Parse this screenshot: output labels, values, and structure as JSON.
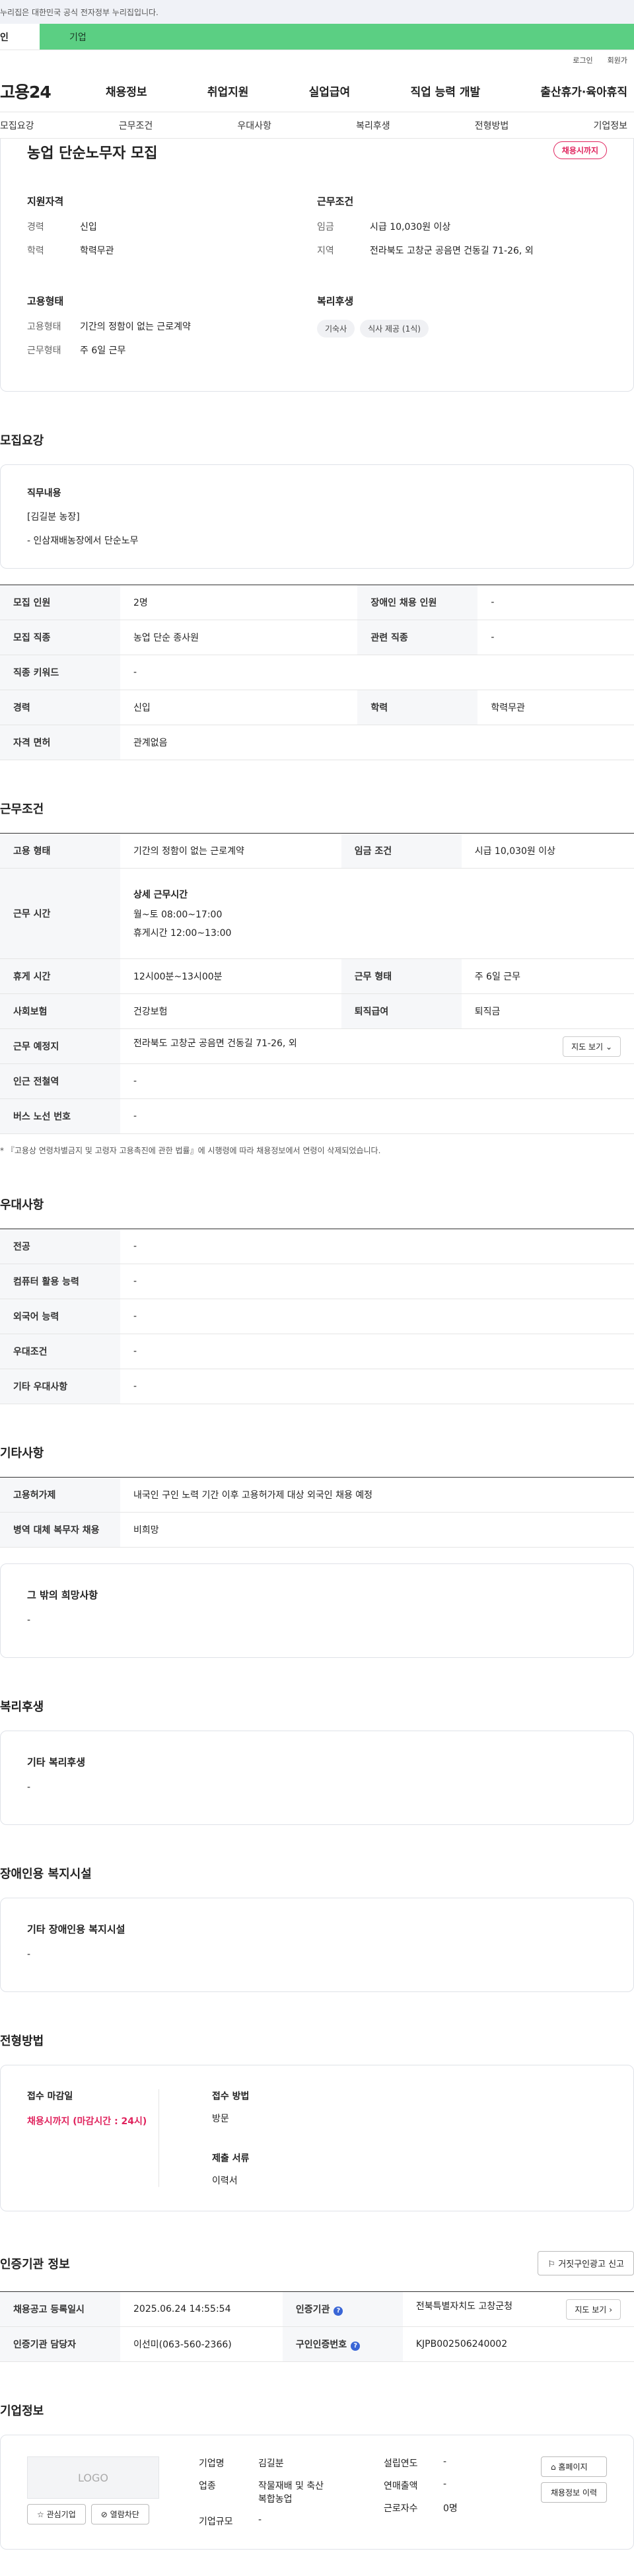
{
  "gov_notice": "누리집은 대한민국 공식 전자정부 누리집입니다.",
  "user_tabs": [
    "인",
    "기업"
  ],
  "util": [
    "로그인",
    "회원가"
  ],
  "logo": "고용24",
  "gnb": [
    "채용정보",
    "취업지원",
    "실업급여",
    "직업 능력 개발",
    "출산휴가·육아휴직"
  ],
  "anchors": [
    "모집요강",
    "근무조건",
    "우대사항",
    "복리후생",
    "전형방법",
    "기업정보"
  ],
  "summary": {
    "title": "농업 단순노무자 모집",
    "badge": "채용시까지",
    "qual_title": "지원자격",
    "qual": [
      {
        "k": "경력",
        "v": "신입"
      },
      {
        "k": "학력",
        "v": "학력무관"
      }
    ],
    "cond_title": "근무조건",
    "cond": [
      {
        "k": "임금",
        "v": "시급 10,030원 이상"
      },
      {
        "k": "지역",
        "v": "전라북도 고창군 공음면 건동길 71-26, 외"
      }
    ],
    "emp_title": "고용형태",
    "emp": [
      {
        "k": "고용형태",
        "v": "기간의 정함이 없는 근로계약"
      },
      {
        "k": "근무형태",
        "v": "주 6일 근무"
      }
    ],
    "welfare_title": "복리후생",
    "chips": [
      "기숙사",
      "식사 제공 (1식)"
    ]
  },
  "recruit": {
    "title": "모집요강",
    "duty_title": "직무내용",
    "duty_lines": [
      "[김길분 농장]",
      "- 인삼재배농장에서 단순노무"
    ],
    "rows": [
      [
        "모집 인원",
        "2명",
        "장애인 채용 인원",
        "-"
      ],
      [
        "모집 직종",
        "농업 단순 종사원",
        "관련 직종",
        "-"
      ],
      [
        "직종 키워드",
        "-"
      ],
      [
        "경력",
        "신입",
        "학력",
        "학력무관"
      ],
      [
        "자격 면허",
        "관계없음"
      ]
    ]
  },
  "work": {
    "title": "근무조건",
    "r1": [
      "고용 형태",
      "기간의 정함이 없는 근로계약",
      "임금 조건",
      "시급 10,030원 이상"
    ],
    "time_label": "근무 시간",
    "time_head": "상세 근무시간",
    "time_lines": [
      "월~토 08:00~17:00",
      "휴게시간 12:00~13:00"
    ],
    "r3": [
      "휴게 시간",
      "12시00분~13시00분",
      "근무 형태",
      "주 6일 근무"
    ],
    "r4": [
      "사회보험",
      "건강보험",
      "퇴직급여",
      "퇴직금"
    ],
    "place_label": "근무 예정지",
    "place": "전라북도 고창군 공음면 건동길 71-26, 외",
    "map_btn": "지도 보기",
    "r6": [
      "인근 전철역",
      "-"
    ],
    "r7": [
      "버스 노선 번호",
      "-"
    ],
    "note": "* 『고용상 연령차별금지 및 고령자 고용촉진에 관한 법률』에 시행령에 따라 채용정보에서 연령이 삭제되었습니다."
  },
  "pref": {
    "title": "우대사항",
    "rows": [
      [
        "전공",
        "-"
      ],
      [
        "컴퓨터 활용 능력",
        "-"
      ],
      [
        "외국어 능력",
        "-"
      ],
      [
        "우대조건",
        "-"
      ],
      [
        "기타 우대사항",
        "-"
      ]
    ]
  },
  "etc": {
    "title": "기타사항",
    "rows": [
      [
        "고용허가제",
        "내국인 구인 노력 기간 이후 고용허가제 대상 외국인 채용 예정"
      ],
      [
        "병역 대체 복무자 채용",
        "비희망"
      ]
    ],
    "hope_title": "그 밖의 희망사항",
    "hope_val": "-"
  },
  "welfare": {
    "title": "복리후생",
    "h": "기타 복리후생",
    "v": "-"
  },
  "disab": {
    "title": "장애인용 복지시설",
    "h": "기타 장애인용 복지시설",
    "v": "-"
  },
  "method": {
    "title": "전형방법",
    "deadline_h": "접수 마감일",
    "deadline_v": "채용시까지 (마감시간 : 24시)",
    "how_h": "접수 방법",
    "how_v": "방문",
    "docs_h": "제출 서류",
    "docs_v": "이력서"
  },
  "cert": {
    "title": "인증기관 정보",
    "report_btn": "거짓구인광고 신고",
    "rows": [
      [
        "채용공고 등록일시",
        "2025.06.24 14:55:54",
        "인증기관",
        "전북특별자치도 고창군청"
      ],
      [
        "인증기관 담당자",
        "이선미(063-560-2366)",
        "구인인증번호",
        "KJPB002506240002"
      ]
    ],
    "map_btn": "지도 보기"
  },
  "company": {
    "title": "기업정보",
    "logo": "LOGO",
    "like_btn": "관심기업",
    "block_btn": "열람차단",
    "name_k": "기업명",
    "name_v": "김길분",
    "ind_k": "업종",
    "ind_v1": "작물재배 및 축산",
    "ind_v2": "복합농업",
    "size_k": "기업규모",
    "size_v": "-",
    "est_k": "설립연도",
    "est_v": "-",
    "sales_k": "연매출액",
    "sales_v": "-",
    "emp_k": "근로자수",
    "emp_v": "0명",
    "home_btn": "홈페이지",
    "history_btn": "채용정보 이력"
  }
}
